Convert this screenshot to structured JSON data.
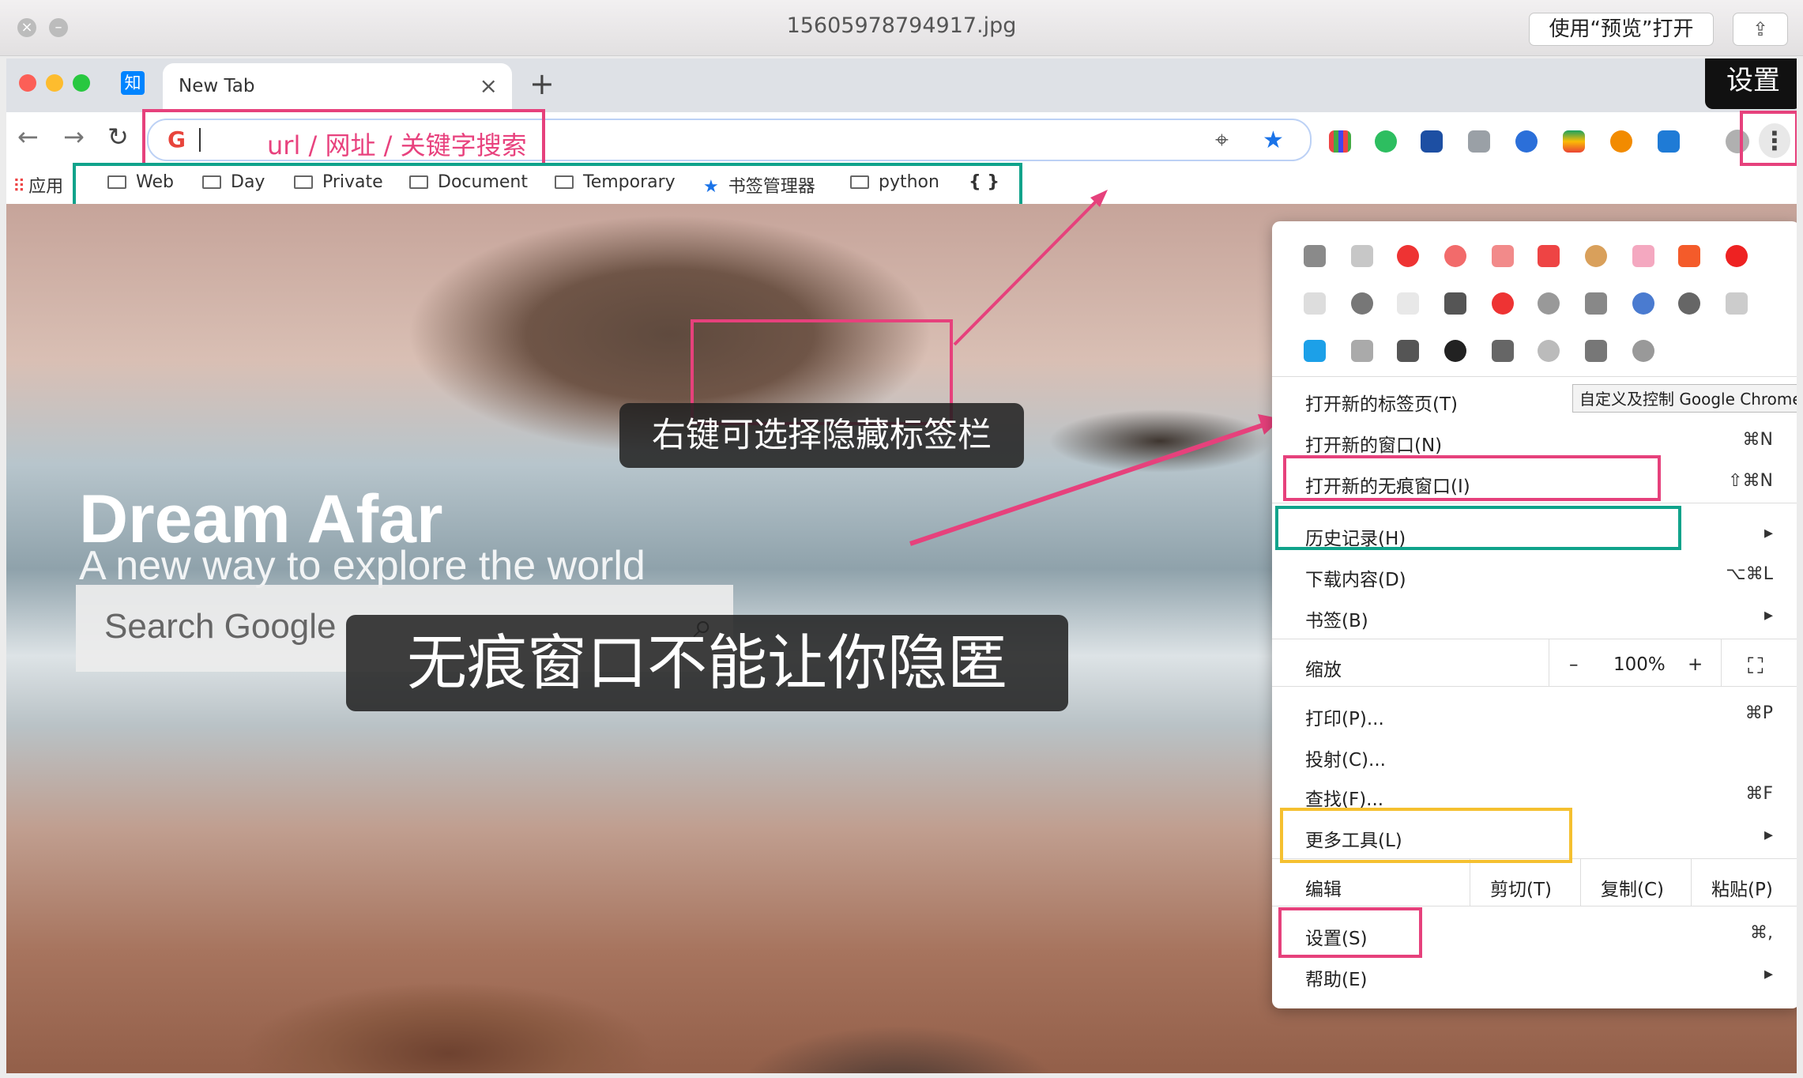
{
  "preview": {
    "title": "15605978794917.jpg",
    "open_with": "使用“预览”打开",
    "share_icon": "share-icon"
  },
  "chrome": {
    "pinned_tab": "知",
    "tab_title": "New Tab",
    "tab_close": "×",
    "new_tab": "+",
    "settings_tooltip": "设置",
    "omnibox_hint": "url / 网址 / 关键字搜索",
    "google_g": "G",
    "menu_dots": "⋮",
    "bookmarks": {
      "apps_label": "应用",
      "items": [
        "Web",
        "Day",
        "Private",
        "Document",
        "Temporary",
        "书签管理器",
        "python"
      ],
      "extra": "{ }"
    }
  },
  "newtab": {
    "brand": "Dream Afar",
    "tagline": "A new way to explore the world",
    "search_placeholder": "Search Google"
  },
  "annotations": {
    "hide_bookmarks_caption": "右键可选择隐藏标签栏",
    "incognito_caption": "无痕窗口不能让你隐匿"
  },
  "menu": {
    "tooltip": "自定义及控制 Google Chrome",
    "new_tab": {
      "label": "打开新的标签页(T)"
    },
    "new_window": {
      "label": "打开新的窗口(N)",
      "shortcut": "⌘N"
    },
    "incognito": {
      "label": "打开新的无痕窗口(I)",
      "shortcut": "⇧⌘N"
    },
    "history": {
      "label": "历史记录(H)",
      "arrow": "▸"
    },
    "downloads": {
      "label": "下载内容(D)",
      "shortcut": "⌥⌘L"
    },
    "bookmarks": {
      "label": "书签(B)",
      "arrow": "▸"
    },
    "zoom": {
      "label": "缩放",
      "minus": "–",
      "value": "100%",
      "plus": "+",
      "fullscreen": "⛶"
    },
    "print": {
      "label": "打印(P)...",
      "shortcut": "⌘P"
    },
    "cast": {
      "label": "投射(C)..."
    },
    "find": {
      "label": "查找(F)...",
      "shortcut": "⌘F"
    },
    "more_tools": {
      "label": "更多工具(L)",
      "arrow": "▸"
    },
    "edit": {
      "label": "编辑",
      "cut": "剪切(T)",
      "copy": "复制(C)",
      "paste": "粘贴(P)"
    },
    "settings": {
      "label": "设置(S)",
      "shortcut": "⌘,"
    },
    "help": {
      "label": "帮助(E)",
      "arrow": "▸"
    }
  },
  "colors": {
    "annotation_pink": "#e6417c",
    "annotation_teal": "#10a38b",
    "annotation_yellow": "#f5c030"
  }
}
